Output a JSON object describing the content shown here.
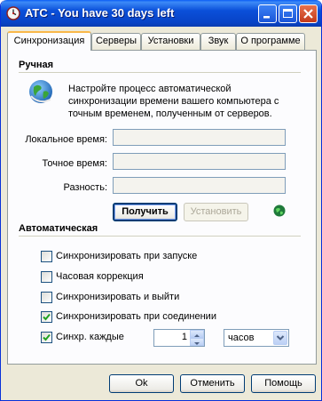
{
  "window": {
    "title": "ATC - You have 30 days left"
  },
  "tabs": [
    {
      "label": "Синхронизация",
      "active": true
    },
    {
      "label": "Серверы"
    },
    {
      "label": "Установки"
    },
    {
      "label": "Звук"
    },
    {
      "label": "О программе"
    }
  ],
  "manual": {
    "title": "Ручная",
    "description": "Настройте процесс автоматической синхронизации времени вашего компьютера с точным временем, полученным от серверов.",
    "local_time_label": "Локальное время:",
    "local_time_value": "",
    "exact_time_label": "Точное время:",
    "exact_time_value": "",
    "difference_label": "Разность:",
    "difference_value": "",
    "get_button": "Получить",
    "set_button": "Установить"
  },
  "auto": {
    "title": "Автоматическая",
    "options": [
      {
        "label": "Синхронизировать при запуске",
        "checked": false
      },
      {
        "label": "Часовая коррекция",
        "checked": false
      },
      {
        "label": "Синхронизировать и выйти",
        "checked": false
      },
      {
        "label": "Синхронизировать при соединении",
        "checked": true
      },
      {
        "label": "Синхр. каждые",
        "checked": true
      }
    ],
    "interval_value": "1",
    "interval_unit": "часов"
  },
  "footer": {
    "ok": "Ok",
    "cancel": "Отменить",
    "help": "Помощь"
  },
  "colors": {
    "titlebar": "#0a4fd9",
    "tab_highlight": "#f9b84a",
    "dialog_bg": "#ece9d8",
    "panel_bg": "#fcfcfe"
  }
}
